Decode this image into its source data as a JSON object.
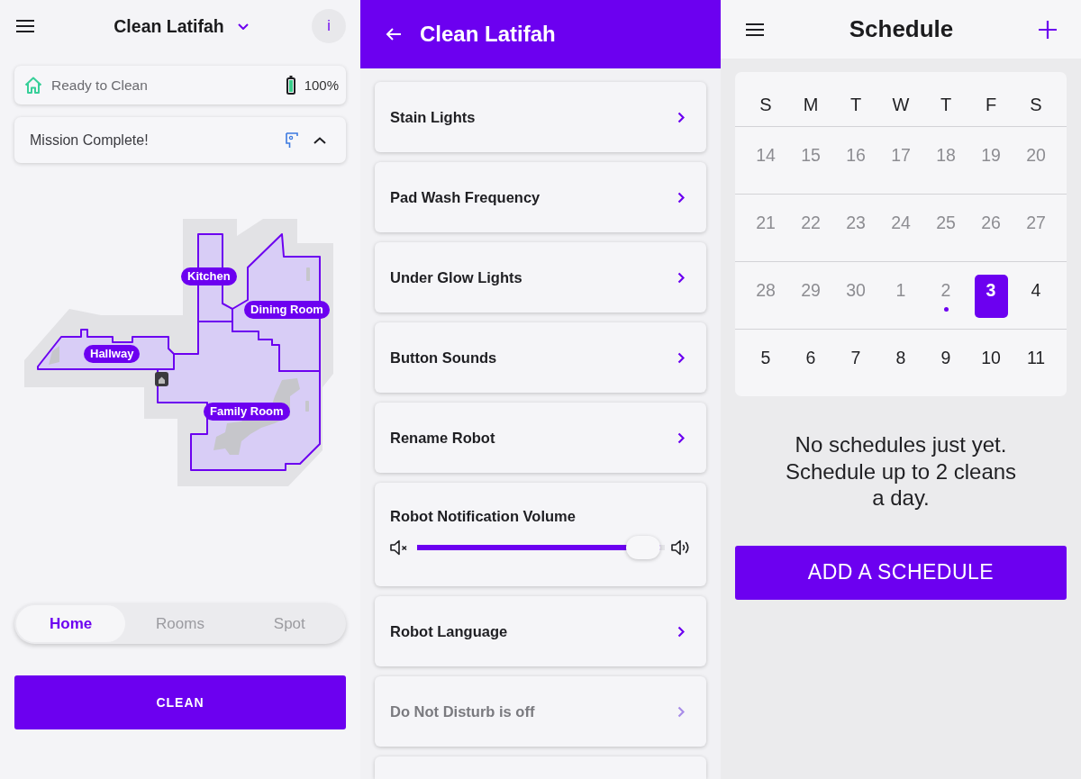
{
  "home_screen": {
    "header": {
      "title": "Clean Latifah",
      "info_label": "i"
    },
    "status": {
      "text": "Ready to Clean",
      "battery": "100%"
    },
    "mission": {
      "text": "Mission Complete!",
      "expanded": true
    },
    "map": {
      "rooms": [
        {
          "label": "Kitchen"
        },
        {
          "label": "Dining Room"
        },
        {
          "label": "Hallway"
        },
        {
          "label": "Family Room"
        }
      ]
    },
    "modes": [
      {
        "label": "Home",
        "selected": true
      },
      {
        "label": "Rooms",
        "selected": false
      },
      {
        "label": "Spot",
        "selected": false
      }
    ],
    "clean_button": "CLEAN"
  },
  "settings_screen": {
    "header": {
      "title": "Clean Latifah"
    },
    "items": [
      {
        "kind": "link",
        "label": "Stain Lights",
        "disabled": false
      },
      {
        "kind": "link",
        "label": "Pad Wash Frequency",
        "disabled": false
      },
      {
        "kind": "link",
        "label": "Under Glow Lights",
        "disabled": false
      },
      {
        "kind": "link",
        "label": "Button Sounds",
        "disabled": false
      },
      {
        "kind": "link",
        "label": "Rename Robot",
        "disabled": false
      },
      {
        "kind": "slider",
        "label": "Robot Notification Volume",
        "disabled": false,
        "level": 0.98
      },
      {
        "kind": "link",
        "label": "Robot Language",
        "disabled": false
      },
      {
        "kind": "link",
        "label": "Do Not Disturb is off",
        "disabled": true
      }
    ]
  },
  "schedule_screen": {
    "header": {
      "title": "Schedule"
    },
    "calendar": {
      "weekdays": [
        "S",
        "M",
        "T",
        "W",
        "T",
        "F",
        "S"
      ],
      "weeks": [
        [
          {
            "day": "14",
            "past": true,
            "selected": false,
            "has_schedule": false
          },
          {
            "day": "15",
            "past": true,
            "selected": false,
            "has_schedule": false
          },
          {
            "day": "16",
            "past": true,
            "selected": false,
            "has_schedule": false
          },
          {
            "day": "17",
            "past": true,
            "selected": false,
            "has_schedule": false
          },
          {
            "day": "18",
            "past": true,
            "selected": false,
            "has_schedule": false
          },
          {
            "day": "19",
            "past": true,
            "selected": false,
            "has_schedule": false
          },
          {
            "day": "20",
            "past": true,
            "selected": false,
            "has_schedule": false
          }
        ],
        [
          {
            "day": "21",
            "past": true,
            "selected": false,
            "has_schedule": false
          },
          {
            "day": "22",
            "past": true,
            "selected": false,
            "has_schedule": false
          },
          {
            "day": "23",
            "past": true,
            "selected": false,
            "has_schedule": false
          },
          {
            "day": "24",
            "past": true,
            "selected": false,
            "has_schedule": false
          },
          {
            "day": "25",
            "past": true,
            "selected": false,
            "has_schedule": false
          },
          {
            "day": "26",
            "past": true,
            "selected": false,
            "has_schedule": false
          },
          {
            "day": "27",
            "past": true,
            "selected": false,
            "has_schedule": false
          }
        ],
        [
          {
            "day": "28",
            "past": true,
            "selected": false,
            "has_schedule": false
          },
          {
            "day": "29",
            "past": true,
            "selected": false,
            "has_schedule": false
          },
          {
            "day": "30",
            "past": true,
            "selected": false,
            "has_schedule": false
          },
          {
            "day": "1",
            "past": true,
            "selected": false,
            "has_schedule": false
          },
          {
            "day": "2",
            "past": true,
            "selected": false,
            "has_schedule": true
          },
          {
            "day": "3",
            "past": false,
            "selected": true,
            "has_schedule": false
          },
          {
            "day": "4",
            "past": false,
            "selected": false,
            "has_schedule": false
          }
        ],
        [
          {
            "day": "5",
            "past": false,
            "selected": false,
            "has_schedule": false
          },
          {
            "day": "6",
            "past": false,
            "selected": false,
            "has_schedule": false
          },
          {
            "day": "7",
            "past": false,
            "selected": false,
            "has_schedule": false
          },
          {
            "day": "8",
            "past": false,
            "selected": false,
            "has_schedule": false
          },
          {
            "day": "9",
            "past": false,
            "selected": false,
            "has_schedule": false
          },
          {
            "day": "10",
            "past": false,
            "selected": false,
            "has_schedule": false
          },
          {
            "day": "11",
            "past": false,
            "selected": false,
            "has_schedule": false
          }
        ]
      ]
    },
    "empty_message": "No schedules just yet. Schedule up to 2 cleans a day.",
    "add_button": "ADD A SCHEDULE"
  }
}
